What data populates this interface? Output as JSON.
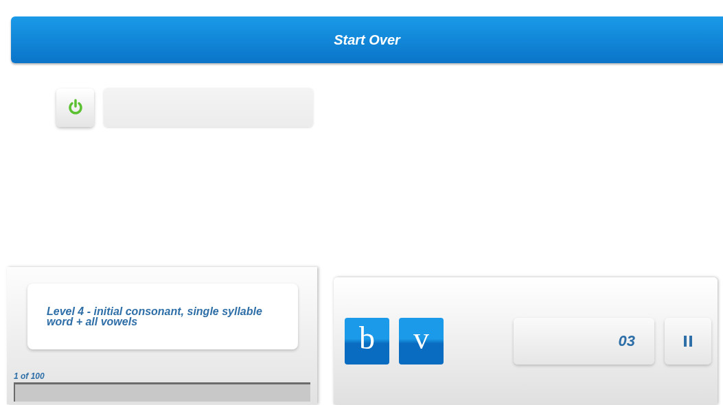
{
  "header": {
    "button": "Start Over"
  },
  "controls": {
    "power_on": true
  },
  "level_card": {
    "text": "Level 4 - initial consonant, single syllable word + all vowels"
  },
  "progress": {
    "label": "1 of 100",
    "level": 0
  },
  "letters": [
    {
      "label": "b"
    },
    {
      "label": "v"
    }
  ],
  "counter": {
    "value": "03"
  },
  "pause_button": {
    "paused": false
  }
}
